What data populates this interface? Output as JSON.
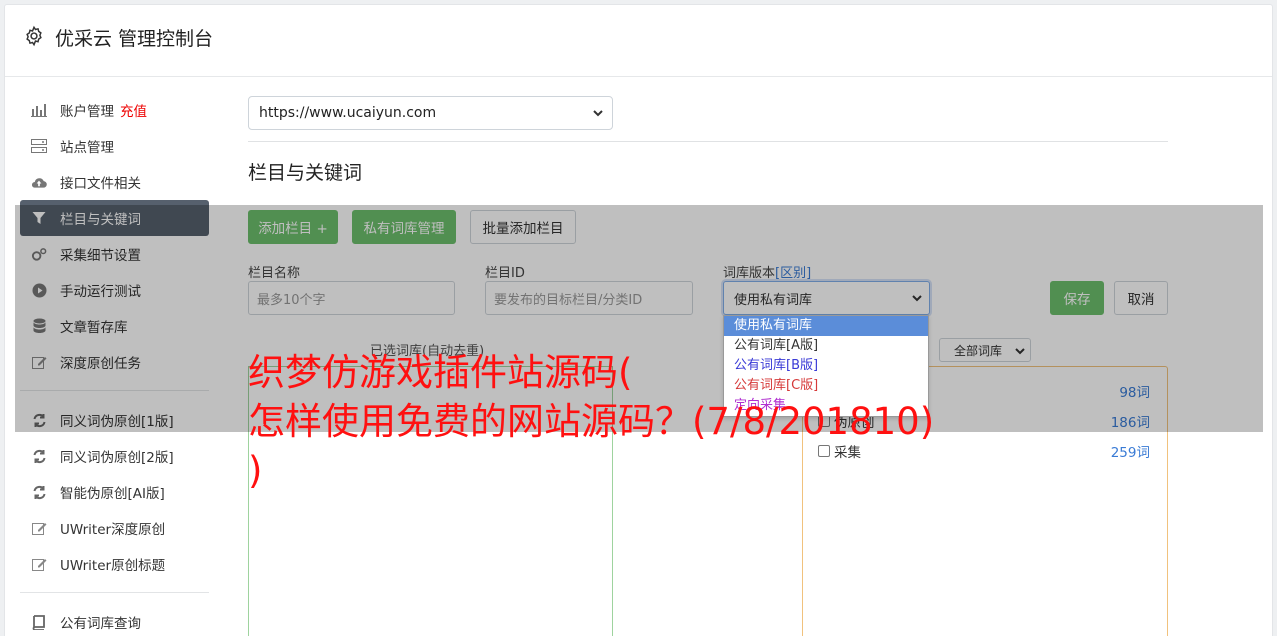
{
  "header": {
    "title": "优采云 管理控制台"
  },
  "sidebar": {
    "group1": [
      {
        "label": "账户管理",
        "badge": "充值",
        "icon": "bar-chart-icon"
      },
      {
        "label": "站点管理",
        "icon": "server-icon"
      },
      {
        "label": "接口文件相关",
        "icon": "cloud-upload-icon"
      },
      {
        "label": "栏目与关键词",
        "icon": "filter-icon",
        "active": true
      },
      {
        "label": "采集细节设置",
        "icon": "cogs-icon"
      },
      {
        "label": "手动运行测试",
        "icon": "play-icon"
      },
      {
        "label": "文章暂存库",
        "icon": "database-icon"
      },
      {
        "label": "深度原创任务",
        "icon": "edit-icon"
      }
    ],
    "group2": [
      {
        "label": "同义词伪原创[1版]",
        "icon": "refresh-icon"
      },
      {
        "label": "同义词伪原创[2版]",
        "icon": "refresh-icon"
      },
      {
        "label": "智能伪原创[AI版]",
        "icon": "refresh-icon"
      },
      {
        "label": "UWriter深度原创",
        "icon": "edit-icon"
      },
      {
        "label": "UWriter原创标题",
        "icon": "edit-icon"
      }
    ],
    "group3": [
      {
        "label": "公有词库查询",
        "icon": "book-icon"
      }
    ]
  },
  "main": {
    "site_select": "https://www.ucaiyun.com",
    "section_title": "栏目与关键词",
    "buttons": {
      "add_column": "添加栏目 +",
      "private_lib": "私有词库管理",
      "batch_add": "批量添加栏目"
    },
    "form": {
      "name_label": "栏目名称",
      "name_placeholder": "最多10个字",
      "id_label": "栏目ID",
      "id_placeholder": "要发布的目标栏目/分类ID",
      "version_label": "词库版本",
      "version_link": "[区别]",
      "version_value": "使用私有词库",
      "save": "保存",
      "cancel": "取消"
    },
    "dropdown_options": [
      {
        "label": "使用私有词库",
        "color": "#ffffff",
        "selected": true
      },
      {
        "label": "公有词库[A版]",
        "color": "#333333"
      },
      {
        "label": "公有词库[B版]",
        "color": "#3a3ad6"
      },
      {
        "label": "公有词库[C版]",
        "color": "#d63a3a"
      },
      {
        "label": "定向采集",
        "color": "#b030d0"
      }
    ],
    "selected_words_label": "已选词库(自动去重)",
    "all_libs": "全部词库",
    "word_rows": [
      {
        "label": "",
        "count": "98词"
      },
      {
        "label": "伪原创",
        "count": "186词"
      },
      {
        "label": "采集",
        "count": "259词"
      }
    ]
  },
  "banner": {
    "line1": "织梦仿游戏插件站源码(",
    "line2": "怎样使用免费的网站源码？(7/8/201810)",
    "line3": ")"
  },
  "colors": {
    "accent_green": "#6cbf6c",
    "active_nav": "#56606d",
    "banner_red": "#ff1010",
    "link_blue": "#3a7bd5"
  }
}
